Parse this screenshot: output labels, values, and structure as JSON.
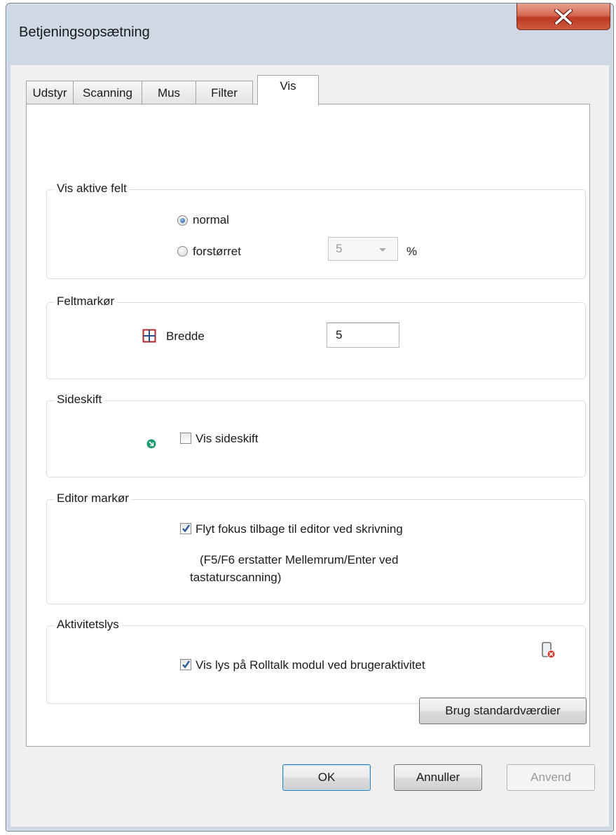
{
  "window": {
    "title": "Betjeningsopsætning",
    "close_icon": "close-icon"
  },
  "tabs": [
    {
      "label": "Udstyr"
    },
    {
      "label": "Scanning"
    },
    {
      "label": "Mus"
    },
    {
      "label": "Filter"
    },
    {
      "label": "Vis",
      "active": true
    }
  ],
  "groups": {
    "active_fields": {
      "title": "Vis aktive felt",
      "normal_label": "normal",
      "normal_selected": true,
      "enlarged_label": "forstørret",
      "enlarged_selected": false,
      "enlarge_value": "5",
      "percent_label": "%"
    },
    "field_cursor": {
      "title": "Feltmarkør",
      "icon": "grid-icon",
      "width_label": "Bredde",
      "width_value": "5"
    },
    "page_break": {
      "title": "Sideskift",
      "icon": "green-arrow-icon",
      "show_label": "Vis sideskift",
      "checked": false
    },
    "editor_cursor": {
      "title": "Editor markør",
      "move_focus_label": "Flyt fokus tilbage til editor ved skrivning",
      "checked": true,
      "note_line1": "(F5/F6 erstatter Mellemrum/Enter ved",
      "note_line2": "tastaturscanning)"
    },
    "activity_light": {
      "title": "Aktivitetslys",
      "icon": "device-error-icon",
      "show_light_label": "Vis lys på Rolltalk modul ved brugeraktivitet",
      "checked": true
    }
  },
  "buttons": {
    "defaults": "Brug standardværdier",
    "ok": "OK",
    "cancel": "Annuller",
    "apply": "Anvend"
  },
  "colors": {
    "accent": "#1b4f8f",
    "close_red": "#c43c22",
    "check_blue": "#2a5d9a"
  }
}
